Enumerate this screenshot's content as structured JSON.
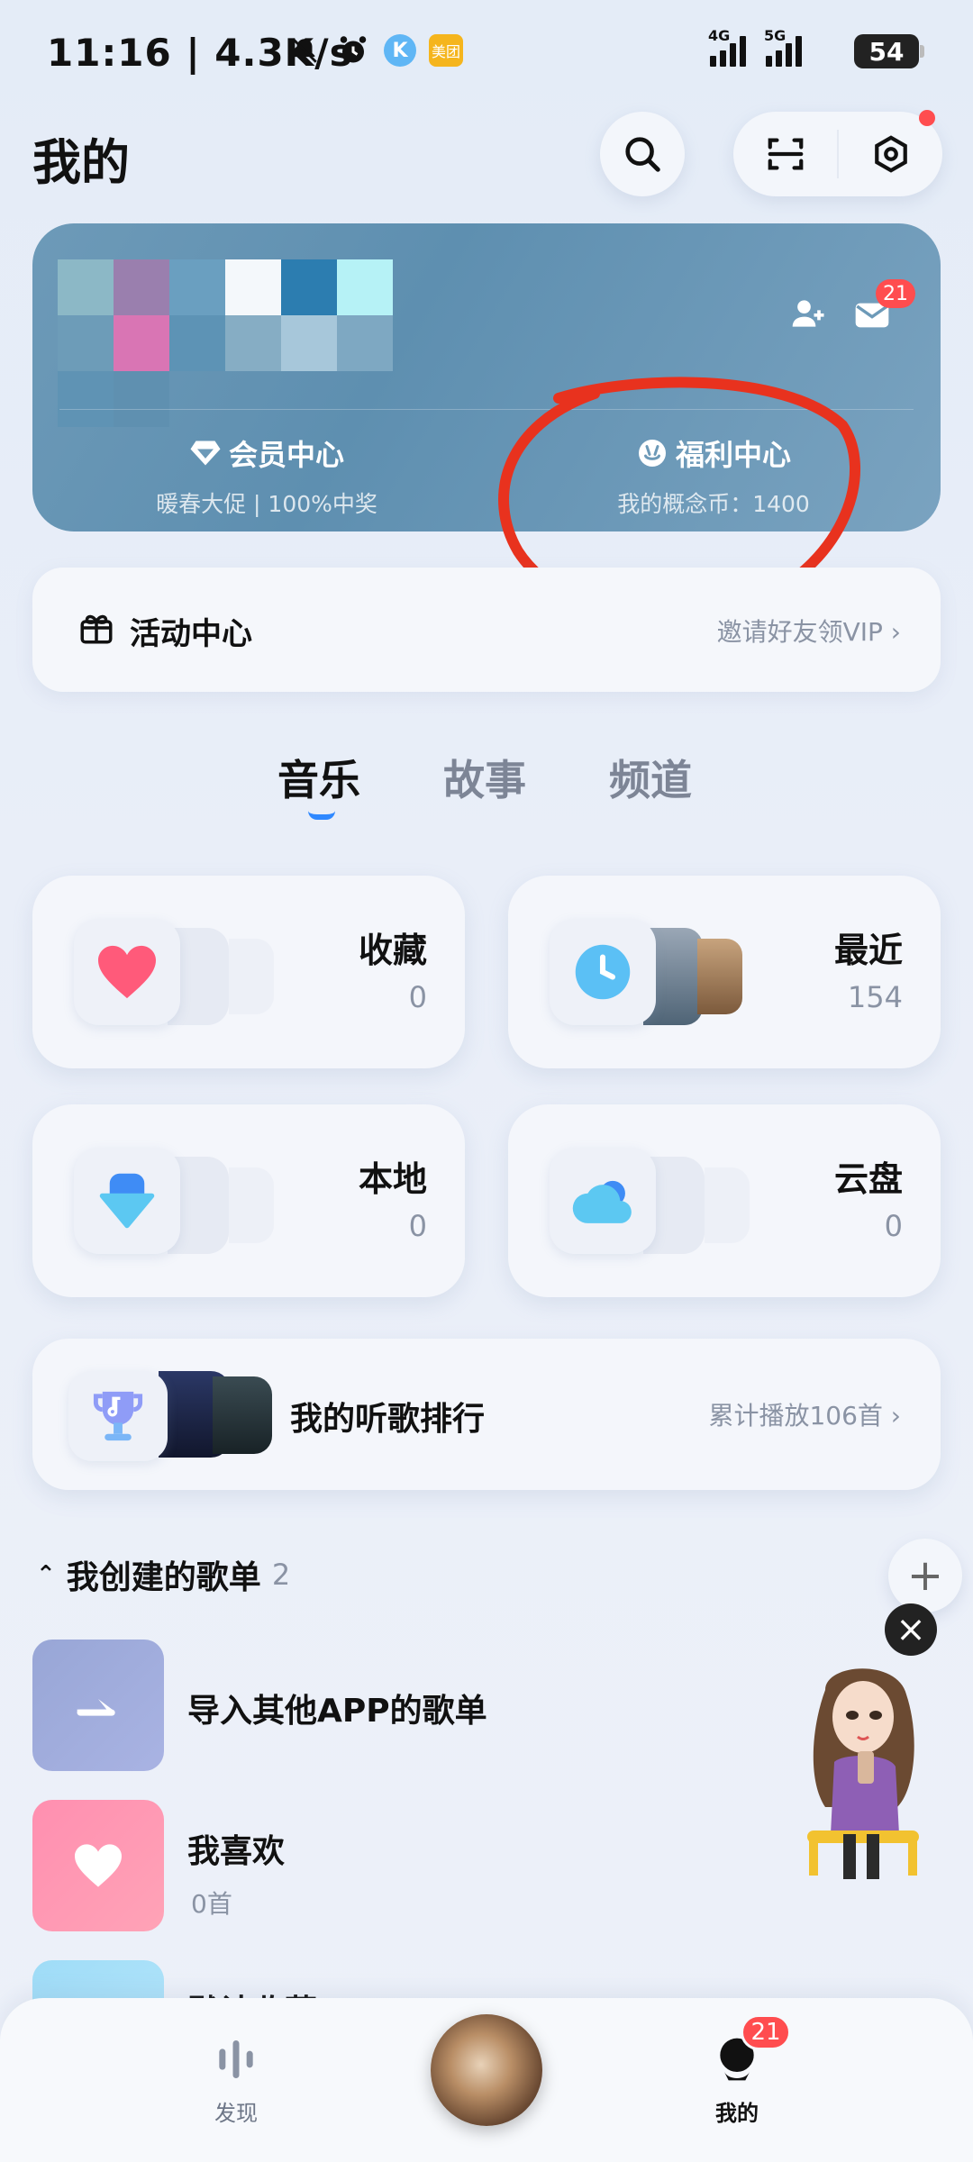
{
  "status_bar": {
    "time": "11:16 | 4.3K/s",
    "k_badge": "K",
    "meituan_badge": "美团",
    "signal_1_label": "4G",
    "signal_2_label": "5G",
    "battery": "54"
  },
  "header": {
    "title": "我的"
  },
  "profile_card": {
    "member_center": {
      "title": "会员中心",
      "subtitle": "暖春大促 | 100%中奖"
    },
    "welfare_center": {
      "title": "福利中心",
      "subtitle": "我的概念币：1400"
    },
    "mail_badge": "21"
  },
  "activity": {
    "title": "活动中心",
    "right_text": "邀请好友领VIP"
  },
  "tabs": [
    {
      "label": "音乐",
      "active": true
    },
    {
      "label": "故事",
      "active": false
    },
    {
      "label": "频道",
      "active": false
    }
  ],
  "library": [
    {
      "label": "收藏",
      "count": "0"
    },
    {
      "label": "最近",
      "count": "154"
    },
    {
      "label": "本地",
      "count": "0"
    },
    {
      "label": "云盘",
      "count": "0"
    }
  ],
  "ranking": {
    "title": "我的听歌排行",
    "right_text": "累计播放106首"
  },
  "playlists": {
    "header": "我创建的歌单",
    "count": "2",
    "items": [
      {
        "name": "导入其他APP的歌单",
        "sub": ""
      },
      {
        "name": "我喜欢",
        "sub": "0首"
      },
      {
        "name": "默认收藏",
        "sub": ""
      }
    ]
  },
  "bottom_nav": {
    "discover": "发现",
    "mine": "我的",
    "mine_badge": "21"
  },
  "colors": {
    "accent": "#2f88ff",
    "badge": "#ff4d4f",
    "annotation": "#e8321e"
  }
}
